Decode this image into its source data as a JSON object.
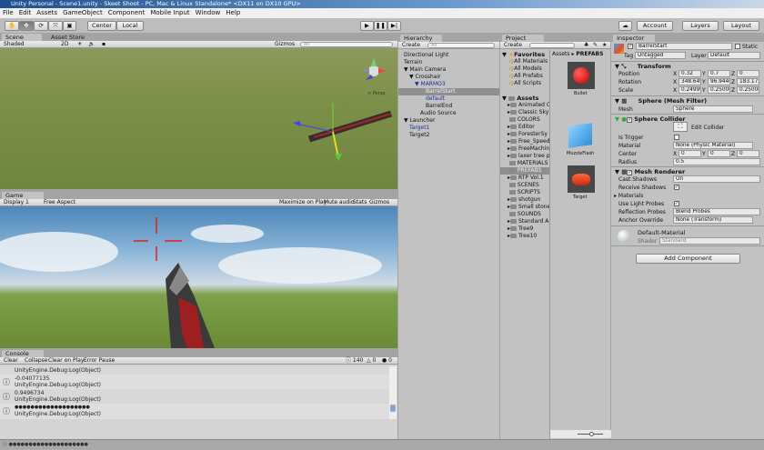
{
  "window": {
    "title": "Unity Personal - Scene1.unity - Skeet Shoot - PC, Mac & Linux Standalone* <DX11 on DX10 GPU>"
  },
  "menu": [
    "File",
    "Edit",
    "Assets",
    "GameObject",
    "Component",
    "Mobile Input",
    "Window",
    "Help"
  ],
  "toolbar": {
    "pivot": "Center",
    "space": "Local",
    "account": "Account",
    "layers": "Layers",
    "layout": "Layout"
  },
  "scene": {
    "tab": "Scene",
    "tab2": "Asset Store",
    "shading": "Shaded",
    "mode2d": "2D",
    "gizmos": "Gizmos",
    "search": "All",
    "persp": "< Persp"
  },
  "game": {
    "tab": "Game",
    "display": "Display 1",
    "aspect": "Free Aspect",
    "maximize": "Maximize on Play",
    "mute": "Mute audio",
    "stats": "Stats",
    "gizmos": "Gizmos"
  },
  "console": {
    "tab": "Console",
    "buttons": [
      "Clear",
      "Collapse",
      "Clear on Play",
      "Error Pause"
    ],
    "counts": {
      "info": "140",
      "warn": "0",
      "error": "0"
    },
    "entries": [
      {
        "line1": "",
        "line2": "UnityEngine.Debug:Log(Object)"
      },
      {
        "line1": "-0.04077135",
        "line2": "UnityEngine.Debug:Log(Object)"
      },
      {
        "line1": "0.9496734",
        "line2": "UnityEngine.Debug:Log(Object)"
      },
      {
        "line1": "●●●●●●●●●●●●●●●●●●●",
        "line2": "UnityEngine.Debug:Log(Object)"
      }
    ],
    "status": "●●●●●●●●●●●●●●●●●●●●"
  },
  "hierarchy": {
    "tab": "Hierarchy",
    "create": "Create",
    "search": "All",
    "items": [
      {
        "label": "Directional Light",
        "indent": 0
      },
      {
        "label": "Terrain",
        "indent": 0
      },
      {
        "label": "▼ Main Camera",
        "indent": 0
      },
      {
        "label": "▼ Crosshair",
        "indent": 1
      },
      {
        "label": "▼ MARMO3",
        "indent": 2,
        "prefab": true
      },
      {
        "label": "BarrelStart",
        "indent": 4,
        "selected": true
      },
      {
        "label": "default",
        "indent": 4,
        "prefab": true
      },
      {
        "label": "BarrelEnd",
        "indent": 4
      },
      {
        "label": "Audio Source",
        "indent": 3
      },
      {
        "label": "▼ Launcher",
        "indent": 0
      },
      {
        "label": "Target1",
        "indent": 1,
        "prefab": true
      },
      {
        "label": "Target2",
        "indent": 1
      }
    ]
  },
  "project": {
    "tab": "Project",
    "create": "Create",
    "favorites": "Favorites",
    "fav_items": [
      "All Materials",
      "All Models",
      "All Prefabs",
      "All Scripts"
    ],
    "assets": "Assets",
    "folders": [
      {
        "label": "Animated C",
        "arrow": true
      },
      {
        "label": "Classic Sky",
        "arrow": true
      },
      {
        "label": "COLORS",
        "arrow": false
      },
      {
        "label": "Editor",
        "arrow": true
      },
      {
        "label": "ForesterSy",
        "arrow": true
      },
      {
        "label": "Free_Speed",
        "arrow": true
      },
      {
        "label": "FreeMachin",
        "arrow": true
      },
      {
        "label": "laxer tree p",
        "arrow": true
      },
      {
        "label": "MATERIALS",
        "arrow": false
      },
      {
        "label": "PREFABS",
        "arrow": false,
        "selected": true
      },
      {
        "label": "RTP Vol.1",
        "arrow": true
      },
      {
        "label": "SCENES",
        "arrow": false
      },
      {
        "label": "SCRIPTS",
        "arrow": false
      },
      {
        "label": "shotgun",
        "arrow": true
      },
      {
        "label": "Small stone",
        "arrow": true
      },
      {
        "label": "SOUNDS",
        "arrow": false
      },
      {
        "label": "Standard A",
        "arrow": true
      },
      {
        "label": "Tree9",
        "arrow": true
      },
      {
        "label": "Tree10",
        "arrow": true
      }
    ],
    "breadcrumb": {
      "root": "Assets",
      "current": "PREFABS"
    },
    "prefabs": [
      "Bullet",
      "MuzzleFlash",
      "Target"
    ]
  },
  "inspector": {
    "tab": "Inspector",
    "name": "BarrelStart",
    "static": "Static",
    "tag_label": "Tag",
    "tag": "Untagged",
    "layer_label": "Layer",
    "layer": "Default",
    "transform": {
      "title": "Transform",
      "position_label": "Position",
      "rotation_label": "Rotation",
      "scale_label": "Scale",
      "position": [
        "0.32",
        "0.7",
        "0"
      ],
      "rotation": [
        "348.649",
        "96.9446",
        "183.173"
      ],
      "scale": [
        "0.24999",
        "0.25000",
        "0.25000"
      ]
    },
    "mesh_filter": {
      "title": "Sphere (Mesh Filter)",
      "mesh_label": "Mesh",
      "mesh": "Sphere"
    },
    "collider": {
      "title": "Sphere Collider",
      "edit": "Edit Collider",
      "trigger_label": "Is Trigger",
      "material_label": "Material",
      "material": "None (Physic Material)",
      "center_label": "Center",
      "center": [
        "0",
        "0",
        "0"
      ],
      "radius_label": "Radius",
      "radius": "0.5"
    },
    "renderer": {
      "title": "Mesh Renderer",
      "cast_label": "Cast Shadows",
      "cast": "On",
      "receive_label": "Receive Shadows",
      "materials_label": "Materials",
      "probes_label": "Use Light Probes",
      "refl_label": "Reflection Probes",
      "refl": "Blend Probes",
      "anchor_label": "Anchor Override",
      "anchor": "None (Transform)"
    },
    "material": {
      "name": "Default-Material",
      "shader_label": "Shader",
      "shader": "Standard"
    },
    "add_component": "Add Component"
  }
}
